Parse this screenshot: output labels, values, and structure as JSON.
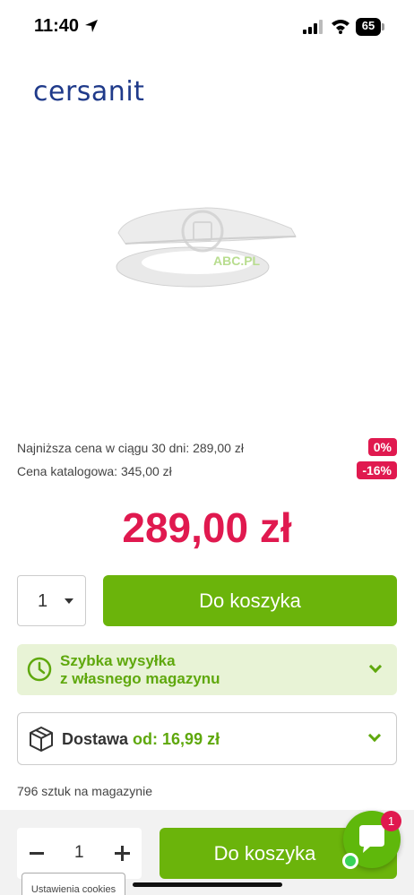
{
  "status_bar": {
    "time": "11:40",
    "battery": "65",
    "icons": [
      "location-arrow-icon",
      "signal-bars-icon",
      "wifi-icon",
      "battery-icon"
    ]
  },
  "brand": {
    "logo_text": "cersanit"
  },
  "product": {
    "image_watermark": "ABC.PL",
    "lowest_price_label": "Najniższa cena w ciągu 30 dni: 289,00 zł",
    "lowest_price_badge": "0%",
    "catalog_price_label": "Cena katalogowa: 345,00 zł",
    "catalog_price_badge": "-16%",
    "price": "289,00 zł"
  },
  "purchase": {
    "quantity": "1",
    "add_to_cart_label": "Do koszyka"
  },
  "shipping": {
    "line1": "Szybka wysyłka",
    "line2": "z własnego magazynu"
  },
  "delivery": {
    "label": "Dostawa",
    "price": "od: 16,99 zł"
  },
  "stock": {
    "text": "796 sztuk na magazynie"
  },
  "bottom_bar": {
    "quantity": "1",
    "add_to_cart_label": "Do koszyka"
  },
  "chat": {
    "badge_count": "1"
  },
  "cookies": {
    "label": "Ustawienia cookies"
  },
  "colors": {
    "accent_green": "#6bb40b",
    "price_red": "#e0194f",
    "brand_blue": "#1f3a8a",
    "shipping_bg": "#e8f3d6"
  }
}
